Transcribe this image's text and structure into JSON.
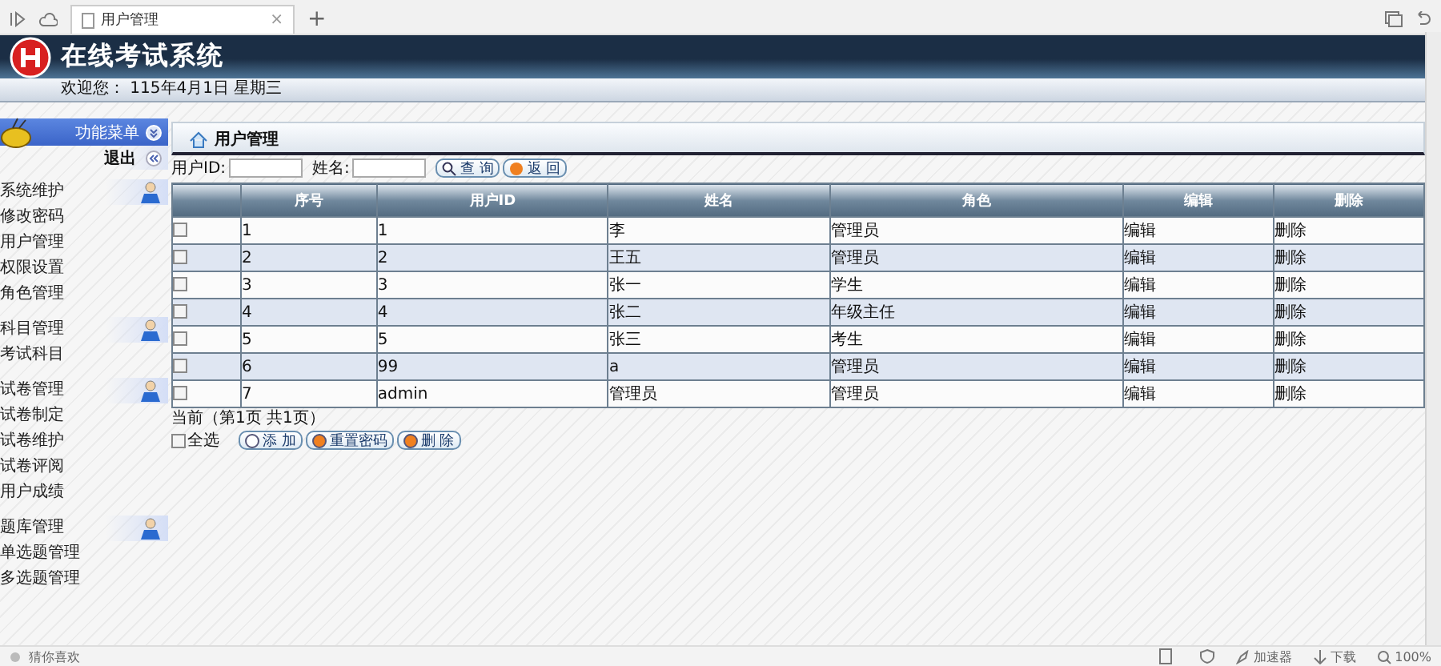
{
  "browser": {
    "tab_title": "用户管理",
    "close": "×",
    "new_tab": "+"
  },
  "header": {
    "title": "在线考试系统",
    "welcome": "欢迎您： 115年4月1日 星期三"
  },
  "sidebar": {
    "title": "功能菜单",
    "logout": "退出",
    "groups": [
      {
        "label": "系统维护",
        "children": [
          {
            "label": "修改密码"
          },
          {
            "label": "用户管理"
          },
          {
            "label": "权限设置"
          },
          {
            "label": "角色管理"
          }
        ]
      },
      {
        "label": "科目管理",
        "children": [
          {
            "label": "考试科目"
          }
        ]
      },
      {
        "label": "试卷管理",
        "children": [
          {
            "label": "试卷制定"
          },
          {
            "label": "试卷维护"
          },
          {
            "label": "试卷评阅"
          },
          {
            "label": "用户成绩"
          }
        ]
      },
      {
        "label": "题库管理",
        "children": [
          {
            "label": "单选题管理"
          },
          {
            "label": "多选题管理"
          }
        ]
      }
    ]
  },
  "panel": {
    "title": "用户管理",
    "search": {
      "fields": [
        {
          "label": "用户ID:"
        },
        {
          "label": "姓名:"
        }
      ],
      "buttons": [
        "查 询",
        "返 回"
      ]
    },
    "table": {
      "columns": [
        "序号",
        "用户ID",
        "姓名",
        "角色",
        "编辑",
        "删除"
      ],
      "rows": [
        {
          "checked": false,
          "cells": [
            "1",
            "1",
            "李",
            "管理员",
            "编辑",
            "删除"
          ]
        },
        {
          "checked": false,
          "cells": [
            "2",
            "2",
            "王五",
            "管理员",
            "编辑",
            "删除"
          ]
        },
        {
          "checked": false,
          "cells": [
            "3",
            "3",
            "张一",
            "学生",
            "编辑",
            "删除"
          ]
        },
        {
          "checked": false,
          "cells": [
            "4",
            "4",
            "张二",
            "年级主任",
            "编辑",
            "删除"
          ]
        },
        {
          "checked": false,
          "cells": [
            "5",
            "5",
            "张三",
            "考生",
            "编辑",
            "删除"
          ]
        },
        {
          "checked": false,
          "cells": [
            "6",
            "99",
            "a",
            "管理员",
            "编辑",
            "删除"
          ]
        },
        {
          "checked": false,
          "cells": [
            "7",
            "admin",
            "管理员",
            "管理员",
            "编辑",
            "删除"
          ]
        }
      ]
    },
    "pager": "当前（第1页 共1页）",
    "select_all": {
      "label": "全选",
      "checked": false
    },
    "actions": [
      "添 加",
      "重置密码",
      "删 除"
    ]
  },
  "status_bar": {
    "left": "猜你喜欢",
    "items": [
      "加速器",
      "下载",
      "100%"
    ]
  }
}
